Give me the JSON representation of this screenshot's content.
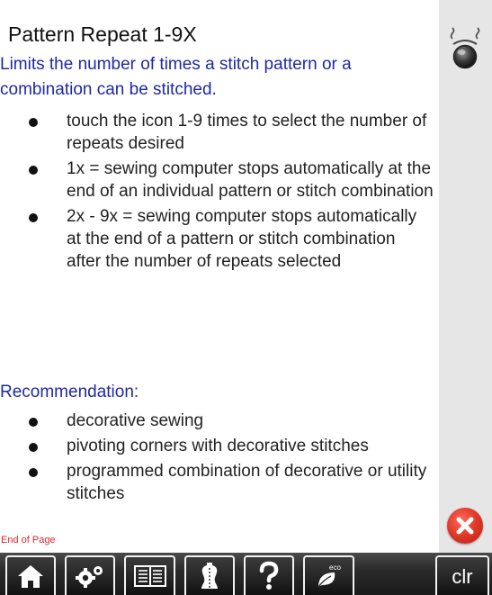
{
  "help": {
    "title": "Pattern Repeat 1-9X",
    "subtitle": "Limits the number of times a stitch pattern or a combination can be stitched.",
    "bullets": [
      "touch the icon 1-9 times to select the number of repeats desired",
      "1x = sewing computer stops automatically at the end of an individual pattern or stitch combination",
      "2x - 9x = sewing computer stops automatically at the end of a pattern or stitch combination after the number of repeats selected"
    ],
    "recommendation_label": "Recommendation:",
    "recommendations": [
      "decorative sewing",
      "pivoting corners with decorative stitches",
      "programmed combination of decorative or utility stitches"
    ],
    "end_of_page": "End of Page"
  },
  "side": {
    "knob_icon": "pattern-repeat-icon",
    "close_icon": "close-icon"
  },
  "toolbar": {
    "buttons": [
      {
        "icon": "home-icon"
      },
      {
        "icon": "settings-icon"
      },
      {
        "icon": "tutorial-book-icon"
      },
      {
        "icon": "sewing-consultant-icon"
      },
      {
        "icon": "help-icon"
      },
      {
        "icon": "eco-icon"
      },
      {
        "label": "clr"
      }
    ]
  },
  "colors": {
    "heading_blue": "#1e2aa0",
    "end_of_page_red": "#e8232a",
    "close_red": "#e33b2c",
    "toolbar_dark": "#1a1a1a",
    "side_gray": "#e6e6e6"
  }
}
